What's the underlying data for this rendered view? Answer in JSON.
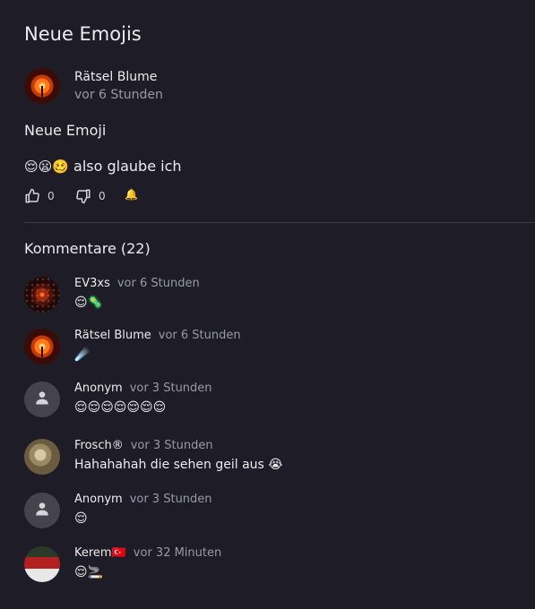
{
  "post": {
    "title": "Neue Emojis",
    "author": "Rätsel Blume",
    "time": "vor 6 Stunden",
    "subject": "Neue Emoji",
    "body_emojis": "😌😦🥴",
    "body_text": " also glaube ich",
    "likes": "0",
    "dislikes": "0",
    "bell": "🔔"
  },
  "comments_section": {
    "title": "Kommentare (22)",
    "items": [
      {
        "name": "EV3xs",
        "time": "vor 6 Stunden",
        "text": "😌🦠",
        "avatar": "hex-avatar"
      },
      {
        "name": "Rätsel Blume",
        "time": "vor 6 Stunden",
        "text": "☄️",
        "avatar": "flower-avatar"
      },
      {
        "name": "Anonym",
        "time": "vor 3 Stunden",
        "text": "😌😌😌😌😌😌😌",
        "avatar": "anonymous-avatar"
      },
      {
        "name": "Frosch®",
        "time": "vor 3 Stunden",
        "text": "Hahahahah die sehen geil aus 😭",
        "avatar": "frog-avatar"
      },
      {
        "name": "Anonym",
        "time": "vor 3 Stunden",
        "text": "😌",
        "avatar": "anonymous-avatar"
      },
      {
        "name": "Kerem🇹🇷",
        "time": "vor 32 Minuten",
        "text": "😌🚬",
        "avatar": "player-avatar"
      }
    ]
  },
  "icons": {
    "like": "thumbs-up-icon",
    "dislike": "thumbs-down-icon",
    "bell": "bell-icon",
    "anonymous": "person-icon"
  },
  "colors": {
    "background": "#1d1c27",
    "text": "#ececf0",
    "muted": "#9a9aa6",
    "divider": "#3b3a47"
  }
}
